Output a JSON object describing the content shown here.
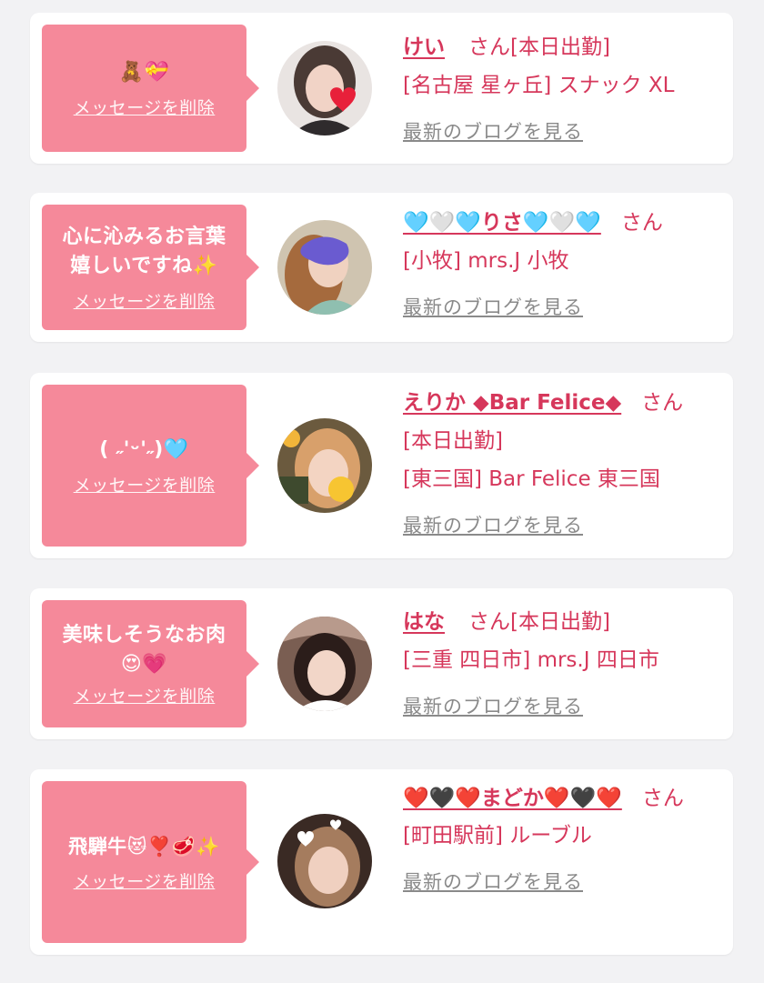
{
  "delete_label": "メッセージを削除",
  "blog_label": "最新のブログを見る",
  "honorific": "さん",
  "colors": {
    "bubble": "#f5899a",
    "text_pink": "#d6375b",
    "link_gray": "#8a8a8a",
    "background": "#f2f2f4"
  },
  "cards": [
    {
      "message": "🧸💝",
      "name": "けい",
      "lines": [
        "[本日出勤]",
        "[名古屋 星ヶ丘] スナック XL"
      ],
      "avatar_icon": "woman-portrait-heart-sticker-icon"
    },
    {
      "message": "心に沁みるお言葉\n嬉しいですね✨",
      "name": "🩵🤍🩵りさ🩵🤍🩵",
      "lines": [
        "[小牧] mrs.J 小牧"
      ],
      "avatar_icon": "woman-portrait-purple-scribble-icon"
    },
    {
      "message": "( ˶'ᵕ'˶)🩵",
      "name": "えりか ◆Bar Felice◆",
      "lines": [
        "[本日出勤]",
        "[東三国] Bar Felice 東三国"
      ],
      "avatar_icon": "woman-portrait-emoji-sticker-icon"
    },
    {
      "message": "美味しそうなお肉\n😍💗",
      "name": "はな",
      "lines": [
        "[本日出勤]",
        "[三重 四日市] mrs.J 四日市"
      ],
      "avatar_icon": "woman-portrait-smiling-icon"
    },
    {
      "message": "飛騨牛😻❣️🥩✨",
      "name": "❤️🖤❤️まどか❤️🖤❤️",
      "lines": [
        "[町田駅前] ルーブル"
      ],
      "avatar_icon": "woman-portrait-heart-filter-icon"
    }
  ]
}
